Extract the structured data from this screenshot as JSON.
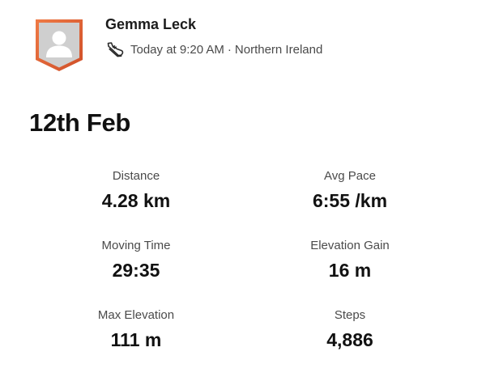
{
  "athlete": {
    "name": "Gemma Leck",
    "avatar_icon": "default-avatar-icon",
    "badge_color": "#e0643a"
  },
  "activity_meta": {
    "sport_icon": "run-shoe-icon",
    "time": "Today at 9:20 AM",
    "separator": "·",
    "location": "Northern Ireland"
  },
  "activity": {
    "title": "12th Feb"
  },
  "stats": [
    {
      "label": "Distance",
      "value": "4.28 km"
    },
    {
      "label": "Avg Pace",
      "value": "6:55 /km"
    },
    {
      "label": "Moving Time",
      "value": "29:35"
    },
    {
      "label": "Elevation Gain",
      "value": "16 m"
    },
    {
      "label": "Max Elevation",
      "value": "111 m"
    },
    {
      "label": "Steps",
      "value": "4,886"
    }
  ]
}
